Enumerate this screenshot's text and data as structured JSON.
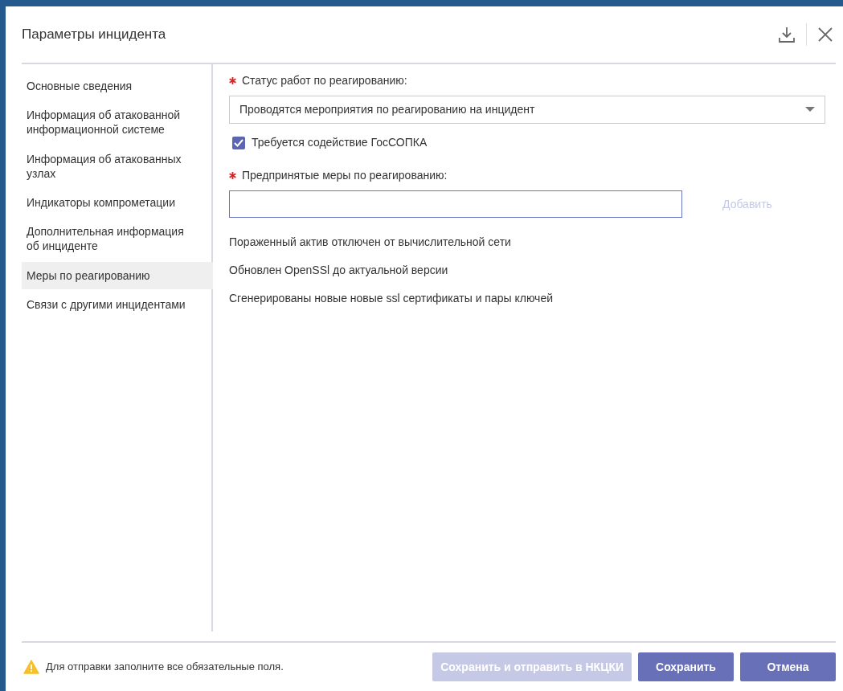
{
  "dialog": {
    "title": "Параметры инцидента"
  },
  "sidebar": {
    "items": [
      {
        "label": "Основные сведения",
        "selected": false
      },
      {
        "label": "Информация об атакованной информационной системе",
        "selected": false
      },
      {
        "label": "Информация об атакованных узлах",
        "selected": false
      },
      {
        "label": "Индикаторы компрометации",
        "selected": false
      },
      {
        "label": "Дополнительная информация об инциденте",
        "selected": false
      },
      {
        "label": "Меры по реагированию",
        "selected": true
      },
      {
        "label": "Связи с другими инцидентами",
        "selected": false
      }
    ]
  },
  "status_field": {
    "label": "Статус работ по реагированию:",
    "required": true,
    "value": "Проводятся мероприятия по реагированию на инцидент"
  },
  "assistance_checkbox": {
    "label": "Требуется содействие ГосСОПКА",
    "checked": true
  },
  "measures_field": {
    "label": "Предпринятые меры по реагированию:",
    "required": true,
    "focused": true
  },
  "add_button": {
    "label": "Добавить",
    "disabled": true
  },
  "measures": [
    "Пораженный актив отключен от вычислительной сети",
    "Обновлен OpenSSl до актуальной версии",
    "Сгенерированы новые новые ssl сертификаты и пары ключей"
  ],
  "footer": {
    "warning": "Для отправки заполните все обязательные поля.",
    "buttons": [
      {
        "label": "Сохранить и отправить в НКЦКИ",
        "disabled": true
      },
      {
        "label": "Сохранить",
        "disabled": false
      },
      {
        "label": "Отмена",
        "disabled": false
      }
    ]
  }
}
